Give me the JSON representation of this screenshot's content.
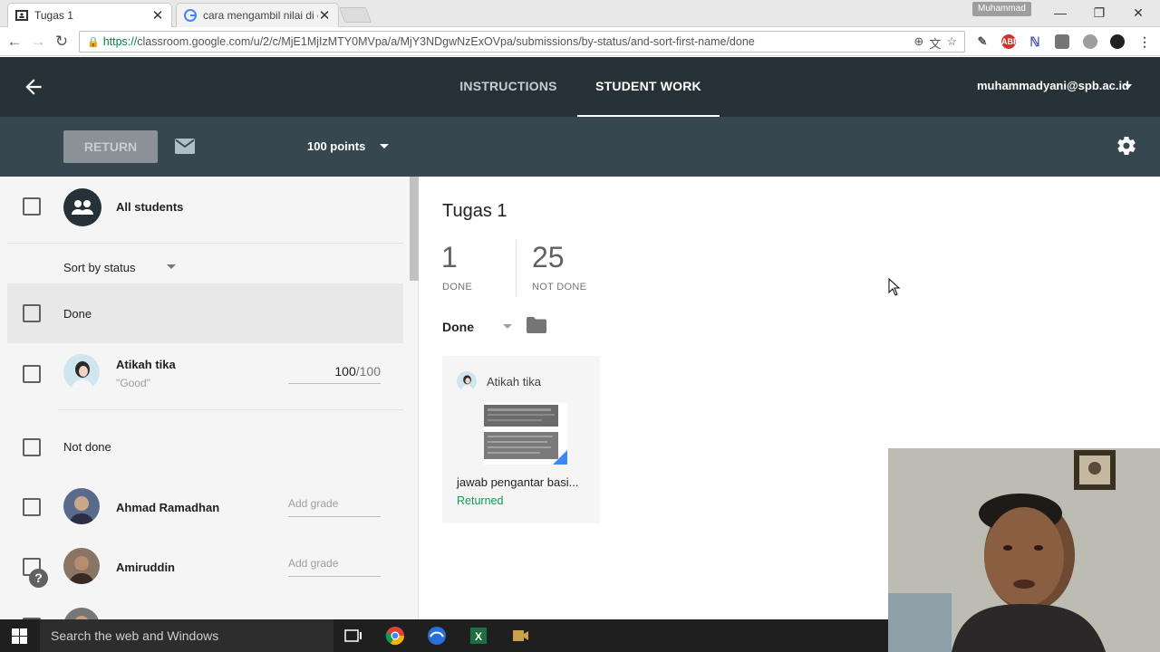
{
  "browser": {
    "tabs": [
      {
        "title": "Tugas 1",
        "active": true
      },
      {
        "title": "cara mengambil nilai di c",
        "active": false
      }
    ],
    "profile": "Muhammad",
    "url_scheme": "https://",
    "url_rest": "classroom.google.com/u/2/c/MjE1MjIzMTY0MVpa/a/MjY3NDgwNzExOVpa/submissions/by-status/and-sort-first-name/done"
  },
  "header": {
    "tabs": [
      {
        "label": "INSTRUCTIONS",
        "active": false
      },
      {
        "label": "STUDENT WORK",
        "active": true
      }
    ],
    "account": "muhammadyani@spb.ac.id"
  },
  "toolbar": {
    "return_label": "RETURN",
    "points_label": "100 points"
  },
  "left_pane": {
    "all_students": "All students",
    "sort_label": "Sort by status",
    "sections": {
      "done": "Done",
      "not_done": "Not done"
    },
    "done_students": [
      {
        "name": "Atikah tika",
        "comment": "\"Good\"",
        "grade": "100",
        "denom": "/100"
      }
    ],
    "not_done_students": [
      {
        "name": "Ahmad Ramadhan",
        "grade_placeholder": "Add grade"
      },
      {
        "name": "Amiruddin",
        "grade_placeholder": "Add grade"
      }
    ]
  },
  "main": {
    "assignment_title": "Tugas 1",
    "stats": [
      {
        "value": "1",
        "label": "DONE"
      },
      {
        "value": "25",
        "label": "NOT DONE"
      }
    ],
    "filter_label": "Done",
    "card": {
      "student": "Atikah tika",
      "file_name": "jawab pengantar basi...",
      "status": "Returned"
    }
  },
  "taskbar": {
    "search_placeholder": "Search the web and Windows"
  },
  "help": "?",
  "colors": {
    "header_bg": "#263238",
    "toolbar_bg": "#37474f",
    "returned_green": "#0f9d58"
  }
}
